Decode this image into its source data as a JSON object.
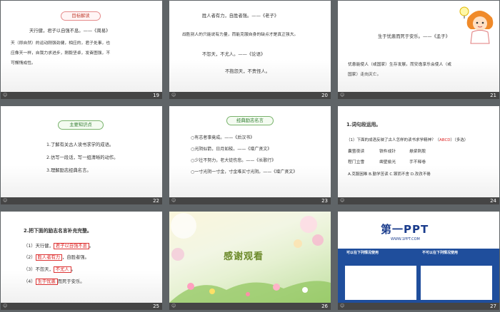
{
  "slides": [
    {
      "num": "19",
      "caption": "目标解读",
      "lines": [
        "天行健，君子以自强不息。——《周易》",
        "天（即自然）的运动刚强劲健，相应的，君子处事，也",
        "应像天一样，自我力求进步，刚毅坚卓，发奋图强，不",
        "可懈惰成性。"
      ]
    },
    {
      "num": "20",
      "lines": [
        "胜人者有力，自胜者强。——《老子》",
        "战胜别人的只能说有力量，而能克服自身的缺点才是真正强大。",
        "不怨天，不尤人。——《论语》",
        "不抱怨天，不责怪人。"
      ]
    },
    {
      "num": "21",
      "lines": [
        "生于忧患而死于安乐。——《孟子》",
        "忧患能使人（或国家）生存发展，而安逸享乐会使人（或",
        "国家）走向灭亡。"
      ]
    },
    {
      "num": "22",
      "caption": "主要知识点",
      "lines": [
        "1.了解有关古人读书求学的成语。",
        "2.仿写一段话，写一组清晰的动作。",
        "3.理解励志经典名言。"
      ]
    },
    {
      "num": "23",
      "caption": "经典励志名言",
      "lines": [
        "○有志者事竟成。——《后汉书》",
        "○光阴似箭，日月如梭。——《增广贤文》",
        "○少壮不努力，老大徒伤悲。——《长歌行》",
        "○一寸光阴一寸金，寸金难买寸光阴。——《增广贤文》"
      ]
    },
    {
      "num": "24",
      "title": "1.词句段运用。",
      "question_pre": "（1）下面的成语反映了古人怎样的读书求学精神？（",
      "answer": "ABCD",
      "question_post": "）（多选）",
      "idioms": [
        "囊萤夜读",
        "铁杵成针",
        "悬梁刺股",
        "程门立雪",
        "凿壁偷光",
        "手不释卷"
      ],
      "options": "A.克服困难  B.勤学苦读  C.锲而不舍  D.孜孜不倦"
    },
    {
      "num": "25",
      "title": "2.把下面的励志名言补充完整。",
      "items": [
        {
          "pre": "（1）天行健，",
          "ans": "君子以自强不息",
          "post": "。"
        },
        {
          "pre": "（2）",
          "ans": "胜人者有力",
          "post": "，自胜者强。"
        },
        {
          "pre": "（3）不怨天，",
          "ans": "不尤人",
          "post": "。"
        },
        {
          "pre": "（4）",
          "ans": "生于忧患",
          "post": "而死于安乐。"
        }
      ]
    },
    {
      "num": "26",
      "thanks": "感谢观看"
    },
    {
      "num": "27",
      "logo": "第一PPT",
      "url": "WWW.1PPT.COM",
      "can_title": "可以在下列情况使用",
      "cannot_title": "不可以在下列情况使用"
    }
  ],
  "watermark": "☺",
  "colors": {
    "accent": "#d22222",
    "footer": "#454545",
    "bg": "#5f6467"
  }
}
